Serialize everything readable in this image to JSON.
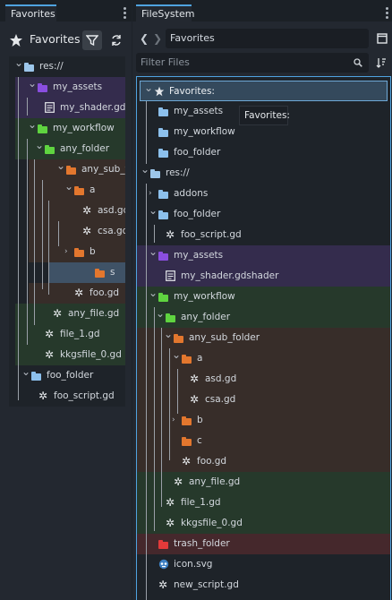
{
  "colors": {
    "purple_folder": "#8a4ee0",
    "green_folder": "#5fd440",
    "orange_folder": "#e3772e",
    "blue_folder": "#8cc0ec",
    "red_folder": "#e33a3a",
    "selection": "#3f5266",
    "accent": "#4fa3e0"
  },
  "left_dock": {
    "tab_label": "Favorites",
    "header_title": "Favorites",
    "tree": [
      {
        "label": "res://",
        "icon": "res-folder-icon",
        "tint": "none"
      },
      {
        "label": "my_assets",
        "icon": "folder-icon",
        "tint": "purple"
      },
      {
        "label": "my_shader.gdshader",
        "icon": "shader-file-icon",
        "tint": "purple"
      },
      {
        "label": "my_workflow",
        "icon": "folder-icon",
        "tint": "green"
      },
      {
        "label": "any_folder",
        "icon": "folder-icon",
        "tint": "green"
      },
      {
        "label": "any_sub_folder",
        "icon": "folder-icon",
        "tint": "orange"
      },
      {
        "label": "a",
        "icon": "folder-icon",
        "tint": "orange"
      },
      {
        "label": "asd.gd",
        "icon": "script-gear-icon",
        "tint": "orange"
      },
      {
        "label": "csa.gd",
        "icon": "script-gear-icon",
        "tint": "orange"
      },
      {
        "label": "b",
        "icon": "folder-icon",
        "tint": "orange"
      },
      {
        "label": "s",
        "icon": "folder-icon",
        "tint": "selected"
      },
      {
        "label": "foo.gd",
        "icon": "script-gear-icon",
        "tint": "orange"
      },
      {
        "label": "any_file.gd",
        "icon": "script-gear-icon",
        "tint": "green"
      },
      {
        "label": "file_1.gd",
        "icon": "script-gear-icon",
        "tint": "green"
      },
      {
        "label": "kkgsfile_0.gd",
        "icon": "script-gear-icon",
        "tint": "green"
      },
      {
        "label": "foo_folder",
        "icon": "folder-icon",
        "tint": "none"
      },
      {
        "label": "foo_script.gd",
        "icon": "script-gear-icon",
        "tint": "none"
      }
    ]
  },
  "right_dock": {
    "tab_label": "FileSystem",
    "path_value": "Favorites",
    "filter_placeholder": "Filter Files",
    "tooltip": "Favorites:",
    "tree": [
      {
        "label": "Favorites:",
        "icon": "star-icon",
        "tint": "none"
      },
      {
        "label": "my_assets",
        "icon": "folder-icon",
        "tint": "none"
      },
      {
        "label": "my_workflow",
        "icon": "folder-icon",
        "tint": "none"
      },
      {
        "label": "foo_folder",
        "icon": "folder-icon",
        "tint": "none"
      },
      {
        "label": "res://",
        "icon": "res-folder-icon",
        "tint": "none"
      },
      {
        "label": "addons",
        "icon": "folder-icon",
        "tint": "none"
      },
      {
        "label": "foo_folder",
        "icon": "folder-icon",
        "tint": "none"
      },
      {
        "label": "foo_script.gd",
        "icon": "script-gear-icon",
        "tint": "none"
      },
      {
        "label": "my_assets",
        "icon": "folder-icon",
        "tint": "purple"
      },
      {
        "label": "my_shader.gdshader",
        "icon": "shader-file-icon",
        "tint": "purple"
      },
      {
        "label": "my_workflow",
        "icon": "folder-icon",
        "tint": "green"
      },
      {
        "label": "any_folder",
        "icon": "folder-icon",
        "tint": "green"
      },
      {
        "label": "any_sub_folder",
        "icon": "folder-icon",
        "tint": "orange"
      },
      {
        "label": "a",
        "icon": "folder-icon",
        "tint": "orange"
      },
      {
        "label": "asd.gd",
        "icon": "script-gear-icon",
        "tint": "orange"
      },
      {
        "label": "csa.gd",
        "icon": "script-gear-icon",
        "tint": "orange"
      },
      {
        "label": "b",
        "icon": "folder-icon",
        "tint": "orange"
      },
      {
        "label": "c",
        "icon": "folder-icon",
        "tint": "orange"
      },
      {
        "label": "foo.gd",
        "icon": "script-gear-icon",
        "tint": "orange"
      },
      {
        "label": "any_file.gd",
        "icon": "script-gear-icon",
        "tint": "green"
      },
      {
        "label": "file_1.gd",
        "icon": "script-gear-icon",
        "tint": "green"
      },
      {
        "label": "kkgsfile_0.gd",
        "icon": "script-gear-icon",
        "tint": "green"
      },
      {
        "label": "trash_folder",
        "icon": "folder-icon",
        "tint": "red"
      },
      {
        "label": "icon.svg",
        "icon": "godot-svg-icon",
        "tint": "none"
      },
      {
        "label": "new_script.gd",
        "icon": "script-gear-icon",
        "tint": "none"
      }
    ]
  }
}
